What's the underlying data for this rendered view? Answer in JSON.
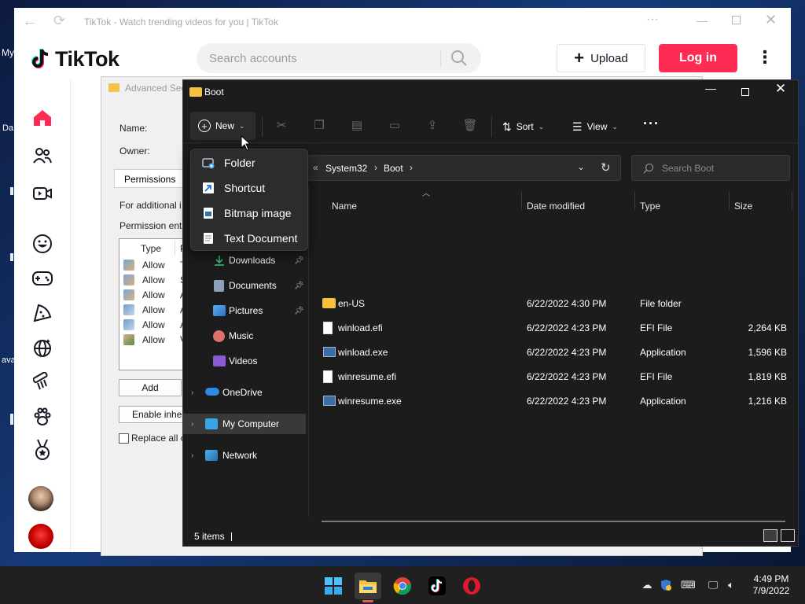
{
  "desktop": {
    "labels": [
      "My",
      "Da",
      "ava"
    ]
  },
  "tiktok": {
    "window_title": "TikTok - Watch trending videos for you | TikTok",
    "brand": "TikTok",
    "search_placeholder": "Search accounts",
    "upload_label": "Upload",
    "login_label": "Log in",
    "nav_icons": [
      "home-icon",
      "following-icon",
      "live-icon",
      "emoji-icon",
      "gaming-icon",
      "food-icon",
      "globe-icon",
      "comb-icon",
      "pet-icon",
      "medal-icon"
    ],
    "accent": "#fe2c55"
  },
  "advanced_security": {
    "title": "Advanced Sec",
    "name_label": "Name:",
    "owner_label": "Owner:",
    "tab_permissions": "Permissions",
    "additional_text": "For additional i",
    "entries_label": "Permission entr",
    "col_type": "Type",
    "col_p": "P",
    "entries": [
      {
        "type": "Allow",
        "p": "T"
      },
      {
        "type": "Allow",
        "p": "S"
      },
      {
        "type": "Allow",
        "p": "A"
      },
      {
        "type": "Allow",
        "p": "A"
      },
      {
        "type": "Allow",
        "p": "A"
      },
      {
        "type": "Allow",
        "p": "V"
      }
    ],
    "add_button": "Add",
    "enable_button": "Enable inhe",
    "replace_label": "Replace all c"
  },
  "explorer": {
    "title": "Boot",
    "toolbar": {
      "new_label": "New",
      "sort_label": "Sort",
      "view_label": "View"
    },
    "breadcrumbs": [
      "System32",
      "Boot"
    ],
    "search_placeholder": "Search Boot",
    "new_menu": [
      {
        "label": "Folder",
        "icon": "new-folder-icon"
      },
      {
        "label": "Shortcut",
        "icon": "shortcut-icon"
      },
      {
        "label": "Bitmap image",
        "icon": "bitmap-icon"
      },
      {
        "label": "Text Document",
        "icon": "text-document-icon"
      }
    ],
    "nav": [
      {
        "label": "Downloads",
        "pinned": true
      },
      {
        "label": "Documents",
        "pinned": true
      },
      {
        "label": "Pictures",
        "pinned": true
      },
      {
        "label": "Music",
        "pinned": false
      },
      {
        "label": "Videos",
        "pinned": false
      },
      {
        "label": "OneDrive",
        "pinned": false
      },
      {
        "label": "My Computer",
        "pinned": false
      },
      {
        "label": "Network",
        "pinned": false
      }
    ],
    "columns": [
      "Name",
      "Date modified",
      "Type",
      "Size"
    ],
    "files": [
      {
        "name": "en-US",
        "date": "6/22/2022 4:30 PM",
        "type": "File folder",
        "size": "",
        "kind": "folder"
      },
      {
        "name": "winload.efi",
        "date": "6/22/2022 4:23 PM",
        "type": "EFI File",
        "size": "2,264 KB",
        "kind": "file"
      },
      {
        "name": "winload.exe",
        "date": "6/22/2022 4:23 PM",
        "type": "Application",
        "size": "1,596 KB",
        "kind": "app"
      },
      {
        "name": "winresume.efi",
        "date": "6/22/2022 4:23 PM",
        "type": "EFI File",
        "size": "1,819 KB",
        "kind": "file"
      },
      {
        "name": "winresume.exe",
        "date": "6/22/2022 4:23 PM",
        "type": "Application",
        "size": "1,216 KB",
        "kind": "app"
      }
    ],
    "status": "5 items"
  },
  "taskbar": {
    "apps": [
      "windows-start-icon",
      "file-explorer-icon",
      "chrome-icon",
      "tiktok-icon",
      "opera-icon"
    ],
    "time": "4:49 PM",
    "date": "7/9/2022"
  }
}
